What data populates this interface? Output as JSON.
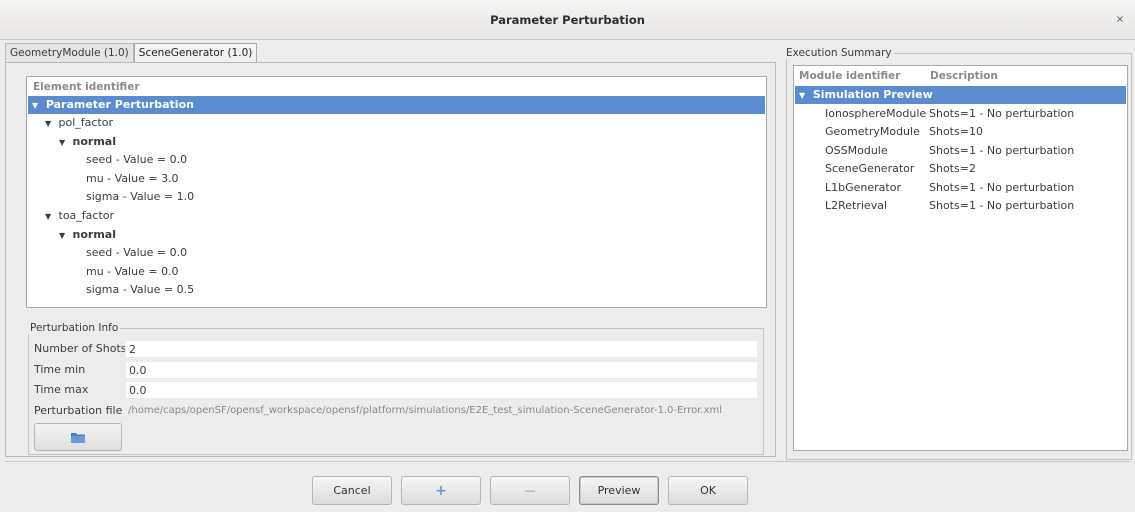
{
  "window": {
    "title": "Parameter Perturbation",
    "close_glyph": "×"
  },
  "tabs": [
    {
      "label": "GeometryModule (1.0)",
      "active": false
    },
    {
      "label": "SceneGenerator (1.0)",
      "active": true
    }
  ],
  "tree": {
    "header": "Element identifier",
    "root": "Parameter Perturbation",
    "params": [
      {
        "name": "pol_factor",
        "dist": "normal",
        "items": [
          "seed - Value = 0.0",
          "mu - Value = 3.0",
          "sigma - Value = 1.0"
        ]
      },
      {
        "name": "toa_factor",
        "dist": "normal",
        "items": [
          "seed - Value = 0.0",
          "mu - Value = 0.0",
          "sigma - Value = 0.5"
        ]
      }
    ]
  },
  "perturbation_info": {
    "title": "Perturbation Info",
    "number_of_shots": {
      "label": "Number of Shots",
      "value": "2"
    },
    "time_min": {
      "label": "Time min",
      "value": "0.0"
    },
    "time_max": {
      "label": "Time max",
      "value": "0.0"
    },
    "perturbation_file": {
      "label": "Perturbation file",
      "value": "/home/caps/openSF/opensf_workspace/opensf/platform/simulations/E2E_test_simulation-SceneGenerator-1.0-Error.xml"
    },
    "folder_icon": "folder-icon"
  },
  "execution_summary": {
    "title": "Execution Summary",
    "col_module": "Module identifier",
    "col_description": "Description",
    "root": "Simulation Preview",
    "rows": [
      {
        "module": "IonosphereModule",
        "description": "Shots=1 - No perturbation"
      },
      {
        "module": "GeometryModule",
        "description": "Shots=10"
      },
      {
        "module": "OSSModule",
        "description": "Shots=1 - No perturbation"
      },
      {
        "module": "SceneGenerator",
        "description": "Shots=2"
      },
      {
        "module": "L1bGenerator",
        "description": "Shots=1 - No perturbation"
      },
      {
        "module": "L2Retrieval",
        "description": "Shots=1 - No perturbation"
      }
    ]
  },
  "buttons": {
    "cancel": "Cancel",
    "add_glyph": "+",
    "remove_glyph": "—",
    "preview": "Preview",
    "ok": "OK"
  },
  "colors": {
    "selection": "#5b8ccf",
    "plus": "#6a9ad6",
    "minus": "#6a9ad6"
  }
}
